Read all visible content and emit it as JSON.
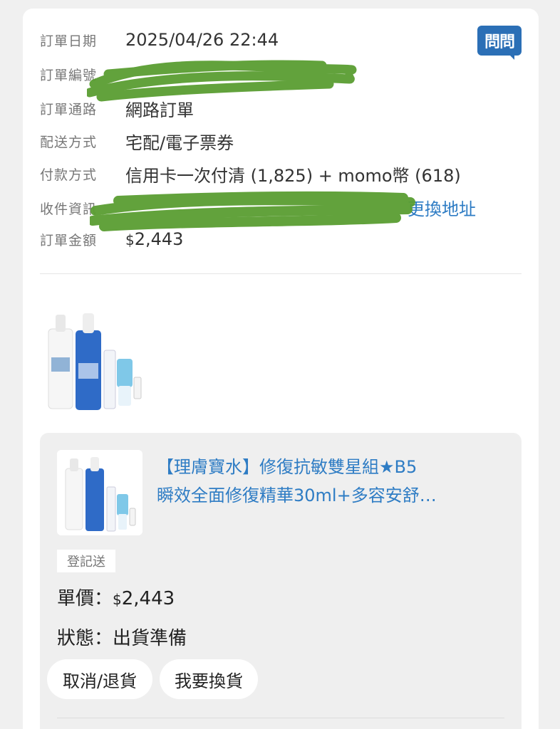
{
  "order": {
    "date_label": "訂單日期",
    "date_value": "2025/04/26 22:44",
    "number_label": "訂單編號",
    "channel_label": "訂單通路",
    "channel_value": "網路訂單",
    "delivery_label": "配送方式",
    "delivery_value": "宅配/電子票券",
    "payment_label": "付款方式",
    "payment_value": "信用卡一次付清 (1,825) + momo幣 (618)",
    "recipient_label": "收件資訊",
    "change_address": "更換地址",
    "amount_label": "訂單金額",
    "amount_currency": "$",
    "amount_value": "2,443"
  },
  "ask_button": {
    "label": "問問",
    "icon": "chat-bubble-icon",
    "color": "#2b6fb6"
  },
  "item": {
    "title_line1": "【理膚寶水】修復抗敏雙星組★B5",
    "title_line2": "瞬效全面修復精華30ml+多容安舒…",
    "tag": "登記送",
    "price_label": "單價：",
    "price_currency": "$",
    "price_value": "2,443",
    "status_label": "狀態：",
    "status_value": "出貨準備",
    "cancel_button": "取消/退貨",
    "exchange_button": "我要換貨"
  },
  "colors": {
    "link": "#2e7cc4",
    "redaction": "#5a9e32"
  }
}
